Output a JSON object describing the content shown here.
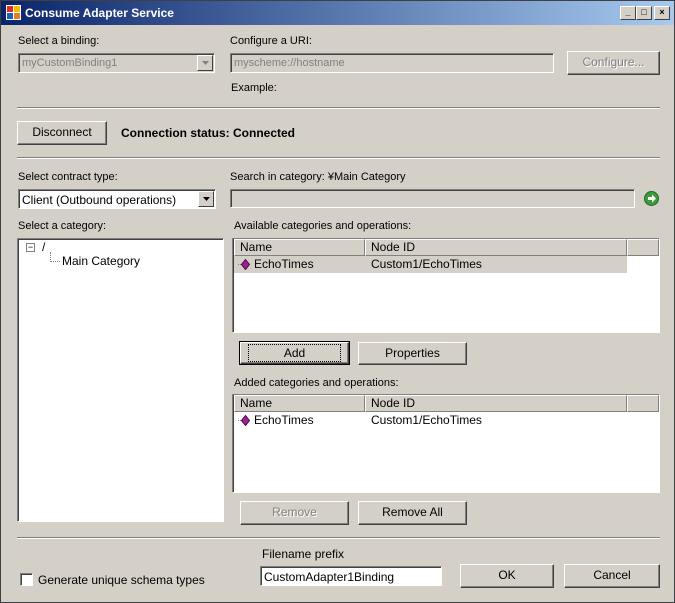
{
  "window": {
    "title": "Consume Adapter Service",
    "controls": {
      "minimize": "_",
      "maximize": "□",
      "close": "×"
    }
  },
  "binding": {
    "label": "Select a binding:",
    "value": "myCustomBinding1"
  },
  "uri": {
    "label": "Configure a URI:",
    "value": "myscheme://hostname",
    "configure_button": "Configure...",
    "example_label": "Example:"
  },
  "connection": {
    "disconnect_button": "Disconnect",
    "status_text": "Connection status: Connected"
  },
  "contract": {
    "label": "Select contract type:",
    "value": "Client (Outbound operations)"
  },
  "search": {
    "label": "Search in category: ¥Main Category",
    "value": ""
  },
  "category": {
    "label": "Select a category:",
    "tree": {
      "root": "/",
      "expander": "−",
      "children": [
        "Main Category"
      ]
    }
  },
  "available": {
    "label": "Available categories and operations:",
    "columns": [
      "Name",
      "Node ID"
    ],
    "rows": [
      {
        "name": "EchoTimes",
        "node_id": "Custom1/EchoTimes"
      }
    ]
  },
  "actions": {
    "add_button": "Add",
    "properties_button": "Properties"
  },
  "added": {
    "label": "Added categories and operations:",
    "columns": [
      "Name",
      "Node ID"
    ],
    "rows": [
      {
        "name": "EchoTimes",
        "node_id": "Custom1/EchoTimes"
      }
    ],
    "remove_button": "Remove",
    "remove_all_button": "Remove All"
  },
  "footer": {
    "filename_prefix_label": "Filename prefix",
    "filename_prefix_value": "CustomAdapter1Binding",
    "generate_checkbox_label": "Generate unique schema types",
    "ok_button": "OK",
    "cancel_button": "Cancel"
  },
  "colors": {
    "titlebar_start": "#0a246a",
    "titlebar_end": "#a6caf0",
    "face": "#d4d0c8",
    "operation_icon": "#a0208a"
  }
}
